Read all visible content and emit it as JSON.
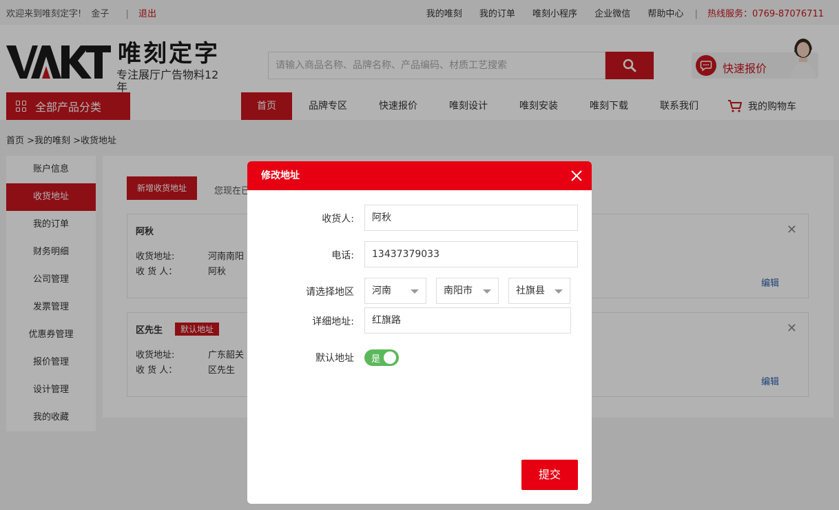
{
  "topbar": {
    "welcome": "欢迎来到唯刻定字!",
    "username": "金子",
    "logout": "退出",
    "links": [
      "我的唯刻",
      "我的订单",
      "唯刻小程序",
      "企业微信",
      "帮助中心"
    ],
    "hotline_label": "热线服务：",
    "hotline": "0769-87076711"
  },
  "header": {
    "logo_mark": "VAKT",
    "logo_cn": "唯刻定字",
    "logo_sub": "专注展厅广告物料12年",
    "search_placeholder": "请输入商品名称、品牌名称、产品编码、材质工艺搜索",
    "quick_quote": "快速报价"
  },
  "nav": {
    "all_categories": "全部产品分类",
    "items": [
      "首页",
      "品牌专区",
      "快速报价",
      "唯刻设计",
      "唯刻安装",
      "唯刻下载",
      "联系我们"
    ],
    "cart": "我的购物车"
  },
  "breadcrumb": "首页 >我的唯刻 >收货地址",
  "sidebar": {
    "items": [
      "账户信息",
      "收货地址",
      "我的订单",
      "财务明细",
      "公司管理",
      "发票管理",
      "优惠券管理",
      "报价管理",
      "设计管理",
      "我的收藏"
    ],
    "active": "收货地址"
  },
  "main": {
    "add_button": "新增收货地址",
    "tip": "您现在已",
    "addresses": [
      {
        "name": "阿秋",
        "address_label": "收货地址:",
        "address": "河南南阳",
        "receiver_label": "收 货 人：",
        "receiver": "阿秋",
        "default_badge": "",
        "edit": "编辑"
      },
      {
        "name": "区先生",
        "address_label": "收货地址:",
        "address": "广东韶关",
        "receiver_label": "收 货 人：",
        "receiver": "区先生",
        "default_badge": "默认地址",
        "edit": "编辑"
      }
    ]
  },
  "dialog": {
    "title": "修改地址",
    "receiver_label": "收货人:",
    "receiver": "阿秋",
    "phone_label": "电话:",
    "phone": "13437379033",
    "region_label": "请选择地区",
    "province": "河南",
    "city": "南阳市",
    "county": "社旗县",
    "detail_label": "详细地址:",
    "detail": "红旗路",
    "default_label": "默认地址",
    "default_toggle": "是",
    "default_on": true,
    "submit": "提交"
  },
  "colors": {
    "brand_red": "#c8161e",
    "dialog_red": "#e60012",
    "toggle_green": "#5cb85c",
    "link_blue": "#2a5fa8"
  }
}
